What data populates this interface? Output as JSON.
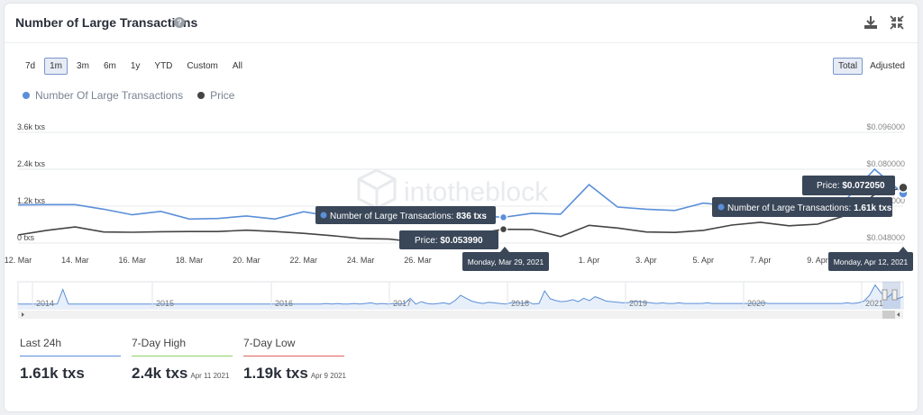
{
  "header": {
    "title": "Number of Large Transactions",
    "help_icon": "question-circle-icon",
    "download_icon": "download-icon",
    "collapse_icon": "collapse-icon"
  },
  "range_buttons": [
    {
      "label": "7d",
      "active": false
    },
    {
      "label": "1m",
      "active": true
    },
    {
      "label": "3m",
      "active": false
    },
    {
      "label": "6m",
      "active": false
    },
    {
      "label": "1y",
      "active": false
    },
    {
      "label": "YTD",
      "active": false
    },
    {
      "label": "Custom",
      "active": false
    },
    {
      "label": "All",
      "active": false
    }
  ],
  "mode_buttons": [
    {
      "label": "Total",
      "active": true
    },
    {
      "label": "Adjusted",
      "active": false
    }
  ],
  "legend": [
    {
      "label": "Number Of Large Transactions",
      "color": "#5b8fd8"
    },
    {
      "label": "Price",
      "color": "#444444"
    }
  ],
  "watermark": "intotheblock",
  "chart_data": {
    "type": "line",
    "x_tick_labels": [
      "12. Mar",
      "14. Mar",
      "16. Mar",
      "18. Mar",
      "20. Mar",
      "22. Mar",
      "24. Mar",
      "26. Mar",
      "1. Apr",
      "3. Apr",
      "5. Apr",
      "7. Apr",
      "9. Apr"
    ],
    "y_left_ticks": [
      "0 txs",
      "1.2k txs",
      "2.4k txs",
      "3.6k txs"
    ],
    "y_left_range": [
      0,
      3600
    ],
    "y_right_ticks": [
      "$0.048000",
      "$0.064000",
      "$0.080000",
      "$0.096000"
    ],
    "y_right_range": [
      0.048,
      0.096
    ],
    "x": [
      "Mar 12",
      "Mar 13",
      "Mar 14",
      "Mar 15",
      "Mar 16",
      "Mar 17",
      "Mar 18",
      "Mar 19",
      "Mar 20",
      "Mar 21",
      "Mar 22",
      "Mar 23",
      "Mar 24",
      "Mar 25",
      "Mar 26",
      "Mar 27",
      "Mar 28",
      "Mar 29",
      "Mar 30",
      "Mar 31",
      "Apr 1",
      "Apr 2",
      "Apr 3",
      "Apr 4",
      "Apr 5",
      "Apr 6",
      "Apr 7",
      "Apr 8",
      "Apr 9",
      "Apr 10",
      "Apr 11",
      "Apr 12"
    ],
    "series": [
      {
        "name": "Number Of Large Transactions",
        "color": "#5b8fd8",
        "values": [
          1240,
          1250,
          1250,
          1100,
          920,
          1030,
          780,
          800,
          880,
          780,
          1020,
          870,
          760,
          820,
          830,
          860,
          900,
          836,
          970,
          940,
          1900,
          1170,
          1100,
          1060,
          1300,
          1200,
          1080,
          1300,
          1190,
          1420,
          2400,
          1610
        ]
      },
      {
        "name": "Price",
        "color": "#444444",
        "values": [
          0.0515,
          0.0535,
          0.055,
          0.0528,
          0.0527,
          0.0529,
          0.053,
          0.053,
          0.0536,
          0.053,
          0.0522,
          0.0512,
          0.05,
          0.0497,
          0.0484,
          0.051,
          0.052,
          0.05399,
          0.0539,
          0.0508,
          0.0557,
          0.0545,
          0.0528,
          0.0526,
          0.0535,
          0.0558,
          0.057,
          0.0555,
          0.0562,
          0.06,
          0.069,
          0.07205
        ]
      }
    ],
    "tooltips": {
      "left": {
        "series_label": "Number of Large Transactions:",
        "series_value": "836 txs",
        "price_label": "Price:",
        "price_value": "$0.053990",
        "date": "Monday, Mar 29, 2021"
      },
      "right": {
        "series_label": "Number of Large Transactions:",
        "series_value": "1.61k txs",
        "price_label": "Price:",
        "price_value": "$0.072050",
        "date": "Monday, Apr 12, 2021"
      }
    },
    "navigator": {
      "year_labels": [
        "2014",
        "2015",
        "2016",
        "2017",
        "2018",
        "2019",
        "2020",
        "2021"
      ],
      "values": [
        10,
        10,
        10,
        10,
        10,
        10,
        10,
        10,
        60,
        10,
        10,
        10,
        10,
        10,
        10,
        10,
        10,
        10,
        10,
        10,
        10,
        10,
        10,
        10,
        10,
        10,
        10,
        10,
        10,
        10,
        10,
        10,
        10,
        10,
        10,
        10,
        10,
        10,
        10,
        10,
        10,
        10,
        10,
        10,
        10,
        10,
        10,
        10,
        10,
        10,
        10,
        10,
        10,
        10,
        10,
        12,
        10,
        12,
        10,
        10,
        12,
        10,
        12,
        14,
        10,
        12,
        10,
        12,
        10,
        12,
        30,
        10,
        18,
        12,
        10,
        12,
        14,
        10,
        22,
        40,
        30,
        20,
        15,
        12,
        16,
        14,
        12,
        10,
        14,
        16,
        12,
        18,
        10,
        12,
        55,
        28,
        22,
        18,
        20,
        25,
        18,
        30,
        22,
        35,
        28,
        20,
        18,
        16,
        14,
        15,
        20,
        18,
        16,
        14,
        12,
        14,
        12,
        12,
        14,
        12,
        12,
        12,
        12,
        14,
        12,
        12,
        12,
        12,
        12,
        12,
        12,
        12,
        12,
        14,
        12,
        12,
        12,
        12,
        12,
        12,
        12,
        12,
        12,
        12,
        12,
        12,
        12,
        12,
        14,
        12,
        14,
        20,
        40,
        75,
        50,
        30,
        45,
        28,
        35
      ]
    }
  },
  "stats": [
    {
      "label": "Last 24h",
      "value": "1.61k txs",
      "date": "",
      "color": "#5b8fd8"
    },
    {
      "label": "7-Day High",
      "value": "2.4k txs",
      "date": "Apr 11 2021",
      "color": "#8fd16a"
    },
    {
      "label": "7-Day Low",
      "value": "1.19k txs",
      "date": "Apr 9 2021",
      "color": "#e06060"
    }
  ]
}
